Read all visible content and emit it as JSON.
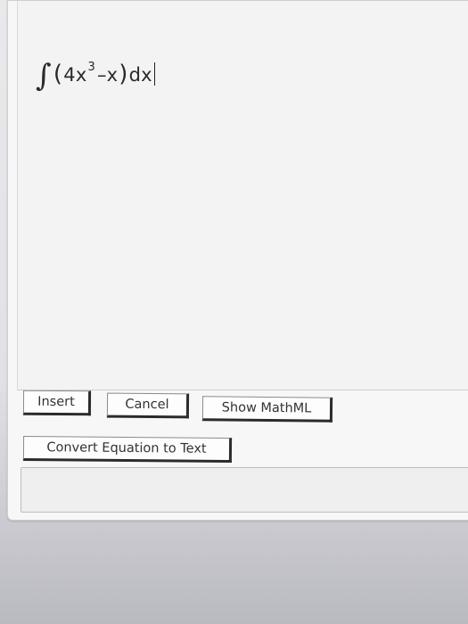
{
  "editor": {
    "equation": {
      "integral": "∫",
      "open_paren": "(",
      "term1": "4x",
      "exponent": "3",
      "minus": "–",
      "term2": "x",
      "close_paren": ")",
      "differential": "dx"
    }
  },
  "buttons": {
    "insert": "Insert",
    "cancel": "Cancel",
    "show_mathml": "Show MathML",
    "convert": "Convert Equation to Text"
  },
  "output": {
    "text": ""
  }
}
